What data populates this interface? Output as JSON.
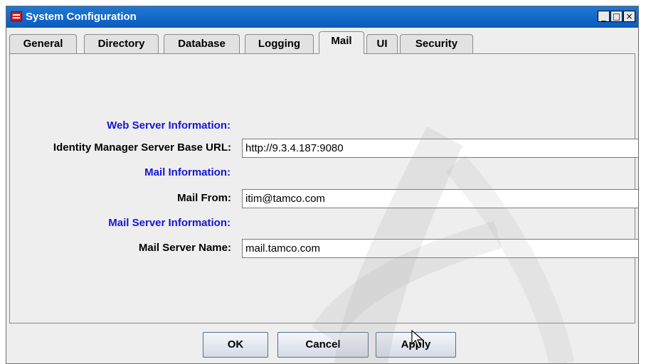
{
  "window": {
    "title": "System Configuration",
    "controls": {
      "minimize": "_",
      "maximize": "□",
      "close": "×"
    }
  },
  "tabs": [
    {
      "label": "General"
    },
    {
      "label": "Directory"
    },
    {
      "label": "Database"
    },
    {
      "label": "Logging"
    },
    {
      "label": "Mail",
      "active": true
    },
    {
      "label": "UI"
    },
    {
      "label": "Security"
    }
  ],
  "form": {
    "web_section": "Web Server Information:",
    "base_url_label": "Identity Manager Server Base URL:",
    "base_url_value": "http://9.3.4.187:9080",
    "mail_section": "Mail Information:",
    "mail_from_label": "Mail From:",
    "mail_from_value": "itim@tamco.com",
    "mail_server_section": "Mail Server Information:",
    "mail_server_label": "Mail Server Name:",
    "mail_server_value": "mail.tamco.com"
  },
  "buttons": {
    "ok": "OK",
    "cancel": "Cancel",
    "apply": "Apply"
  },
  "colors": {
    "titlebar": "#0a5bbd",
    "section_text": "#1515d9",
    "close_icon": "#d32020"
  }
}
